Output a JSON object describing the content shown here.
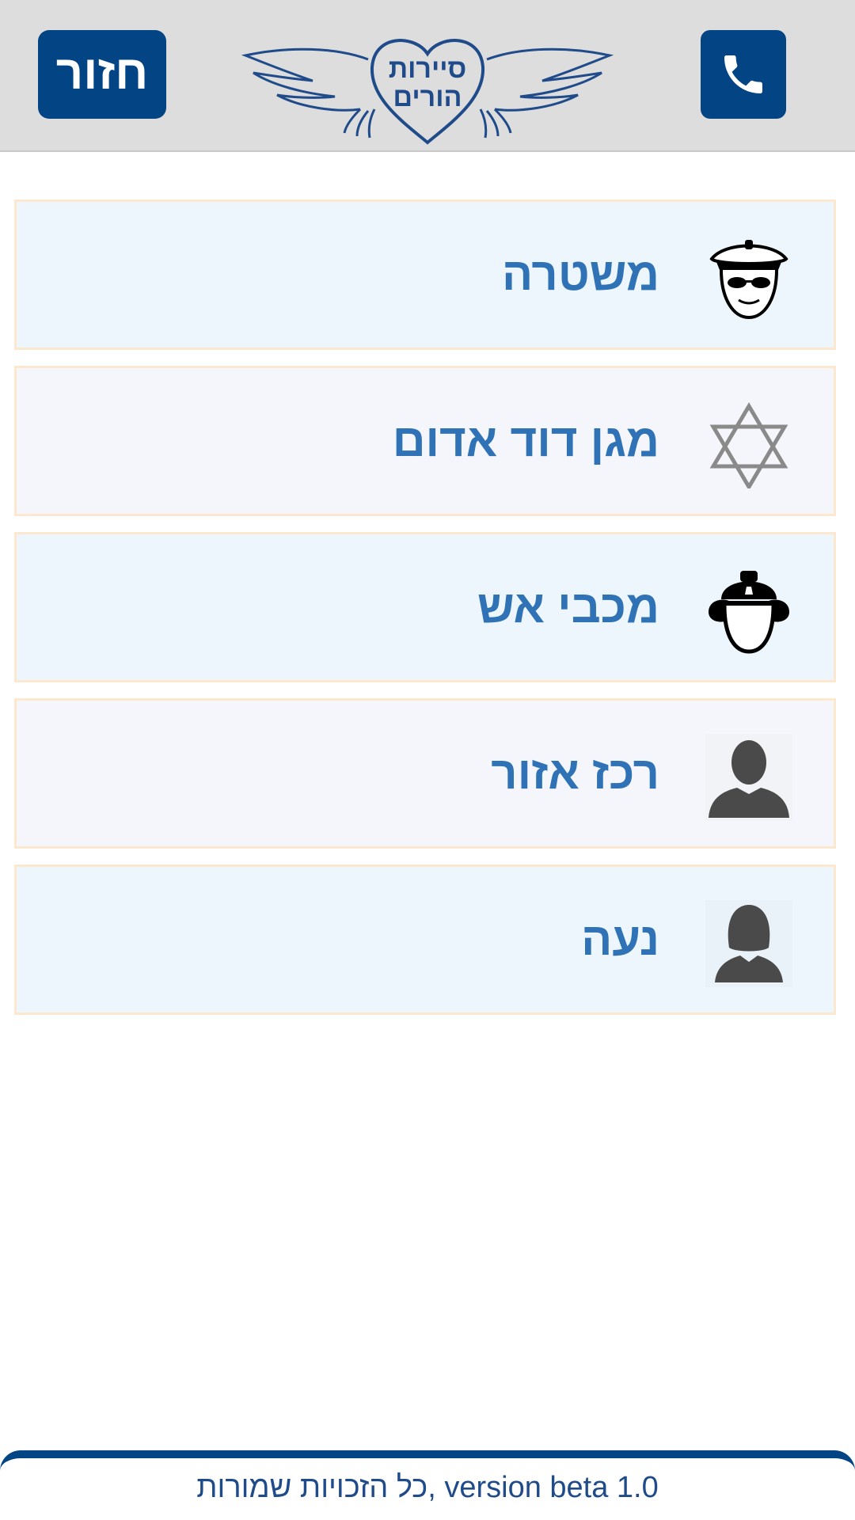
{
  "header": {
    "back_label": "חזור",
    "logo_line1": "סיירות",
    "logo_line2": "הורים",
    "phone_icon": "phone-icon",
    "color_primary": "#024484",
    "color_background": "#dddddd"
  },
  "contacts": [
    {
      "label": "משטרה",
      "icon": "police-officer-icon"
    },
    {
      "label": "מגן דוד אדום",
      "icon": "star-of-david-icon"
    },
    {
      "label": "מכבי אש",
      "icon": "firefighter-icon"
    },
    {
      "label": "רכז אזור",
      "icon": "male-user-icon"
    },
    {
      "label": "נעה",
      "icon": "female-user-icon"
    }
  ],
  "colors": {
    "item_text": "#2f72b5",
    "item_border": "#fbe8cf",
    "item_bg_odd": "#edf6fc",
    "item_bg_even": "#f4f6fb"
  },
  "footer": {
    "text": "כל הזכויות שמורות, version beta 1.0"
  }
}
